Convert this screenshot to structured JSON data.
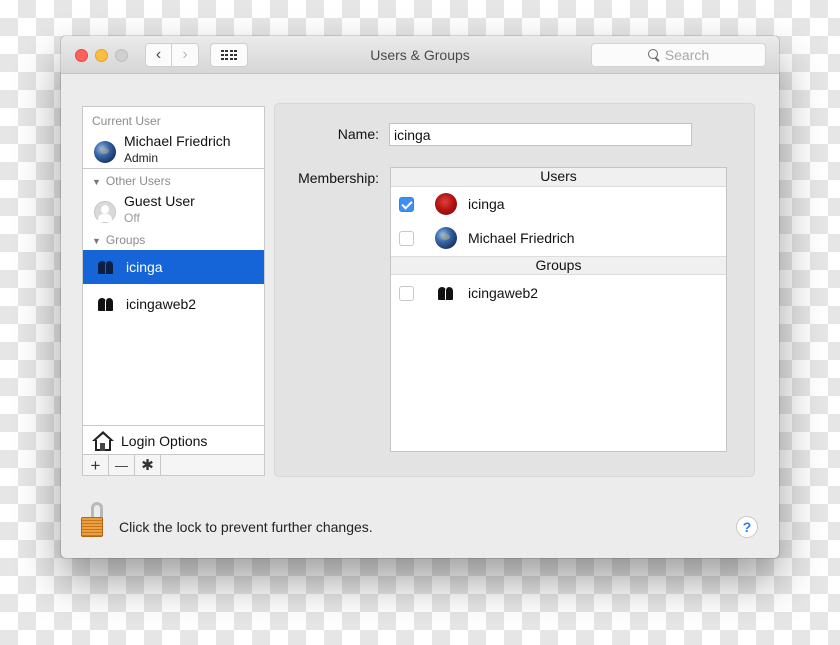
{
  "window": {
    "title": "Users & Groups",
    "search_placeholder": "Search",
    "nav": {
      "back": "‹",
      "forward": "›"
    }
  },
  "sidebar": {
    "current_user_label": "Current User",
    "current_user": {
      "name": "Michael Friedrich",
      "role": "Admin",
      "avatar": "earth-icon"
    },
    "other_users_label": "Other Users",
    "other_users": [
      {
        "name": "Guest User",
        "status": "Off",
        "avatar": "guest-icon"
      }
    ],
    "groups_label": "Groups",
    "groups": [
      {
        "name": "icinga",
        "selected": true
      },
      {
        "name": "icingaweb2",
        "selected": false
      }
    ],
    "login_options_label": "Login Options",
    "add_label": "+",
    "remove_label": "—",
    "gear_label": "✱"
  },
  "detail": {
    "name_label": "Name:",
    "name_value": "icinga",
    "membership_label": "Membership:",
    "users_header": "Users",
    "users": [
      {
        "name": "icinga",
        "checked": true,
        "avatar": "rose-icon"
      },
      {
        "name": "Michael Friedrich",
        "checked": false,
        "avatar": "earth-icon"
      }
    ],
    "groups_header": "Groups",
    "groups": [
      {
        "name": "icingaweb2",
        "checked": false
      }
    ]
  },
  "footer": {
    "lock_text": "Click the lock to prevent further changes.",
    "help_label": "?"
  }
}
